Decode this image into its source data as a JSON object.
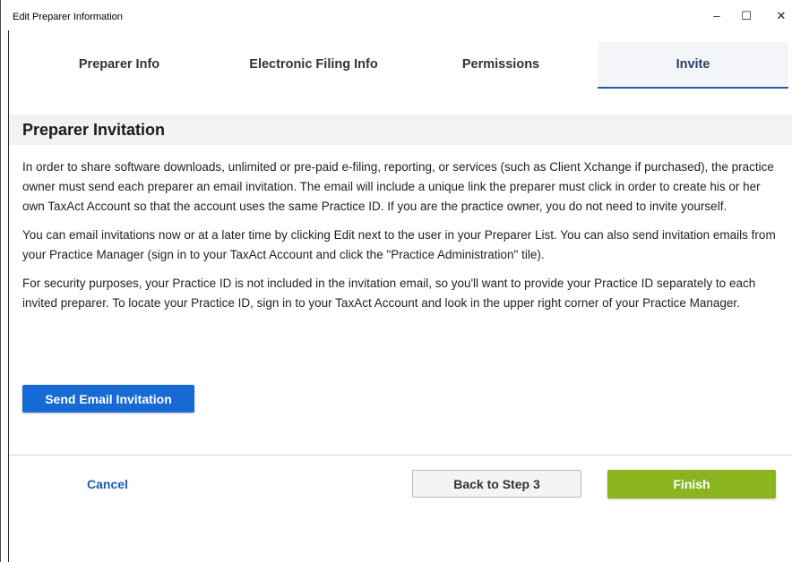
{
  "window": {
    "title": "Edit Preparer Information",
    "controls": {
      "minimize": "–",
      "maximize": "☐",
      "close": "✕"
    }
  },
  "tabs": [
    {
      "label": "Preparer Info",
      "active": false
    },
    {
      "label": "Electronic Filing Info",
      "active": false
    },
    {
      "label": "Permissions",
      "active": false
    },
    {
      "label": "Invite",
      "active": true
    }
  ],
  "section": {
    "title": "Preparer Invitation"
  },
  "paragraphs": [
    "In order to share software downloads, unlimited or pre-paid e-filing, reporting, or services (such as Client Xchange if purchased), the practice owner must send each preparer an email invitation. The email will include a unique link the preparer must click in order to create his or her own TaxAct Account so that the account uses the same Practice ID. If you are the practice owner, you do not need to invite yourself.",
    "You can email invitations now or at a later time by clicking Edit next to the user in your Preparer List. You can also send invitation emails from your Practice Manager (sign in to your TaxAct Account and click the \"Practice Administration\" tile).",
    "For security purposes, your Practice ID is not included in the invitation email, so you'll want to provide your Practice ID separately to each invited preparer. To locate your Practice ID, sign in to your TaxAct Account and look in the upper right corner of your Practice Manager."
  ],
  "buttons": {
    "send_email": "Send Email Invitation",
    "cancel": "Cancel",
    "back": "Back to Step 3",
    "finish": "Finish"
  },
  "colors": {
    "primary_blue": "#1769d4",
    "finish_green": "#8ab51f",
    "link_blue": "#1d5cb4",
    "active_tab_underline": "#2b5ba8"
  }
}
